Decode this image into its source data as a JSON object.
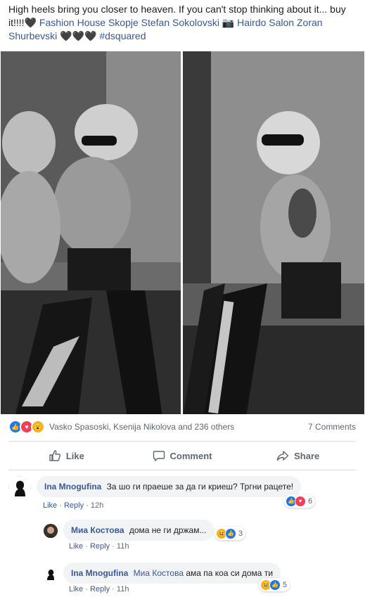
{
  "post": {
    "text_part1": "High heels bring you closer to heaven. If you can't stop thinking about it... buy it!!!!",
    "heart_glyph": "🖤",
    "tag1": "Fashion House Skopje Stefan Sokolovski",
    "camera_glyph": "📷",
    "tag2": "Hairdo Salon Zoran Shurbevski",
    "hearts_glyph": "🖤🖤🖤",
    "hashtag": "#dsquared"
  },
  "photos": [
    {
      "name": "left-photo"
    },
    {
      "name": "right-photo"
    }
  ],
  "reactions": {
    "icons": [
      "like",
      "love",
      "wow"
    ],
    "summary": "Vasko Spasoski, Ksenija Nikolova and 236 others",
    "comments_count": "7 Comments"
  },
  "actions": {
    "like": "Like",
    "comment": "Comment",
    "share": "Share"
  },
  "comments": [
    {
      "author": "Ina Mnogufina",
      "text": "За шо ги праеше за да ги криеш? Тргни рацете!",
      "like_label": "Like",
      "reply_label": "Reply",
      "time": "12h",
      "reaction_count": "6",
      "reaction_icons": [
        "like",
        "love"
      ]
    },
    {
      "author": "Миа Костова",
      "text": "дома не ги држам...",
      "like_label": "Like",
      "reply_label": "Reply",
      "time": "11h",
      "reaction_count": "3",
      "reaction_icons": [
        "haha",
        "like"
      ]
    },
    {
      "author": "Ina Mnogufina",
      "mention": "Миа Костова",
      "text": "ама па коа си дома ти",
      "like_label": "Like",
      "reply_label": "Reply",
      "time": "11h",
      "reaction_count": "5",
      "reaction_icons": [
        "haha",
        "like"
      ]
    }
  ],
  "separator": "·",
  "colors": {
    "link": "#385898",
    "like_blue": "#1877f2",
    "love_red": "#f33e58",
    "wow_yellow": "#f7b125",
    "meta_gray": "#606770"
  }
}
